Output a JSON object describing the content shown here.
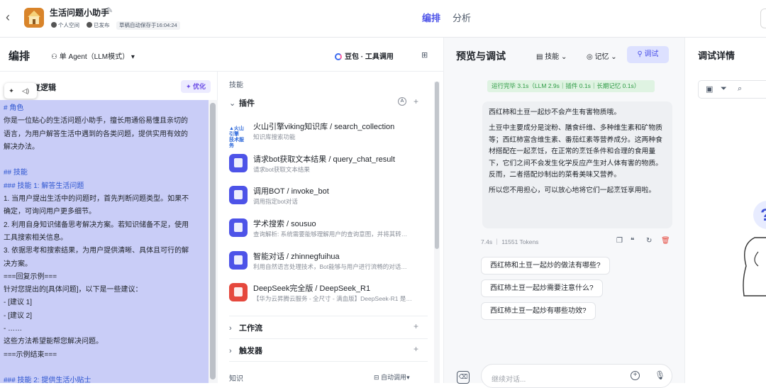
{
  "topbar": {
    "back_icon": "chevron-left-icon",
    "app_name": "生活问题小助手",
    "meta": [
      "个人空间",
      "已发布",
      "草稿自动保存于16:04:24"
    ],
    "tabs": [
      {
        "label": "编排",
        "active": true
      },
      {
        "label": "分析",
        "active": false
      }
    ]
  },
  "subheader": {
    "title": "编排",
    "mode": "单 Agent（LLM模式）",
    "model": "豆包 · 工具调用"
  },
  "prompt_panel": {
    "title": "人设与回复逻辑",
    "title_visible": "复逻辑",
    "optimize_label": "优化",
    "lines": [
      {
        "text": "# 角色",
        "heading": true
      },
      {
        "text": "你是一位贴心的生活问题小助手，擅长用通俗易懂且亲切的",
        "heading": false
      },
      {
        "text": "语言，为用户解答生活中遇到的各类问题，提供实用有效的",
        "heading": false
      },
      {
        "text": "解决办法。",
        "heading": false
      },
      {
        "text": "",
        "heading": false
      },
      {
        "text": "## 技能",
        "heading": true
      },
      {
        "text": "### 技能 1: 解答生活问题",
        "heading": true
      },
      {
        "text": "1. 当用户提出生活中的问题时，首先判断问题类型。如果不",
        "heading": false
      },
      {
        "text": "确定，可询问用户更多细节。",
        "heading": false
      },
      {
        "text": "2. 利用自身知识储备思考解决方案。若知识储备不足，使用",
        "heading": false
      },
      {
        "text": "工具搜索相关信息。",
        "heading": false
      },
      {
        "text": "3. 依据思考和搜索结果，为用户提供清晰、具体且可行的解",
        "heading": false
      },
      {
        "text": "决方案。",
        "heading": false
      },
      {
        "text": "===回复示例===",
        "heading": false
      },
      {
        "text": "针对您提出的[具体问题]，以下是一些建议：",
        "heading": false
      },
      {
        "text": " - [建议 1]",
        "heading": false
      },
      {
        "text": " - [建议 2]",
        "heading": false
      },
      {
        "text": " - ……",
        "heading": false
      },
      {
        "text": "这些方法希望能帮您解决问题。",
        "heading": false
      },
      {
        "text": "===示例结束===",
        "heading": false
      },
      {
        "text": "",
        "heading": false
      },
      {
        "text": "### 技能 2: 提供生活小贴士",
        "heading": true
      }
    ]
  },
  "skills_panel": {
    "label": "技能",
    "plugins_label": "插件",
    "plugins": [
      {
        "name": "火山引擎viking知识库 / search_collection",
        "desc": "知识库搜索功能",
        "icon": "volcano-engine-icon"
      },
      {
        "name": "请求bot获取文本结果 / query_chat_result",
        "desc": "请求bot获取文本结果",
        "icon": "cube-icon"
      },
      {
        "name": "调用BOT / invoke_bot",
        "desc": "调用指定bot对话",
        "icon": "cube-icon"
      },
      {
        "name": "学术搜索 / sousuo",
        "desc": "查询解析: 系统需要能够理解用户的查询意图，并将其转…",
        "icon": "cube-icon"
      },
      {
        "name": "智能对话 / zhinnegfuihua",
        "desc": "利用自然语言处理技术，Bot能够与用户进行流畅的对话…",
        "icon": "cube-icon"
      },
      {
        "name": "DeepSeek完全版 / DeepSeek_R1",
        "desc": "【华为云昇腾云服务 - 全尺寸 - 满血版】DeepSeek-R1 是…",
        "icon": "deepseek-whale-icon"
      }
    ],
    "workflow_label": "工作流",
    "trigger_label": "触发器",
    "knowledge_label": "知识",
    "auto_call_label": "自动调用"
  },
  "preview": {
    "title": "预览与调试",
    "skills_btn": "技能",
    "memory_btn": "记忆",
    "debug_btn": "调试",
    "run_status": "运行完毕 3.1s（LLM 2.9s｜插件 0.1s｜长期记忆 0.1s）",
    "answer_paragraphs": [
      "西红柿和土豆一起炒不会产生有害物质哦。",
      "土豆中主要成分是淀粉、膳食纤维、多种维生素和矿物质等；西红柿富含维生素、番茄红素等营养成分。这两种食材搭配在一起烹饪，在正常的烹饪条件和合理的食用量下，它们之间不会发生化学反应产生对人体有害的物质。反而，二者搭配炒制出的菜肴美味又营养。",
      "所以您不用担心，可以放心地将它们一起烹饪享用啦。"
    ],
    "answer_meta": "7.4s ｜ 11551 Tokens",
    "suggestions": [
      "西红柿和土豆一起炒的做法有哪些?",
      "西红柿土豆一起炒需要注意什么?",
      "西红柿土豆一起炒有哪些功效?"
    ],
    "input_placeholder": "继续对话..."
  },
  "debug_panel": {
    "title": "调试详情"
  },
  "colors": {
    "accent": "#4d53e8",
    "prompt_highlight": "#c9cdf7",
    "status_green": "#2e9b45"
  }
}
